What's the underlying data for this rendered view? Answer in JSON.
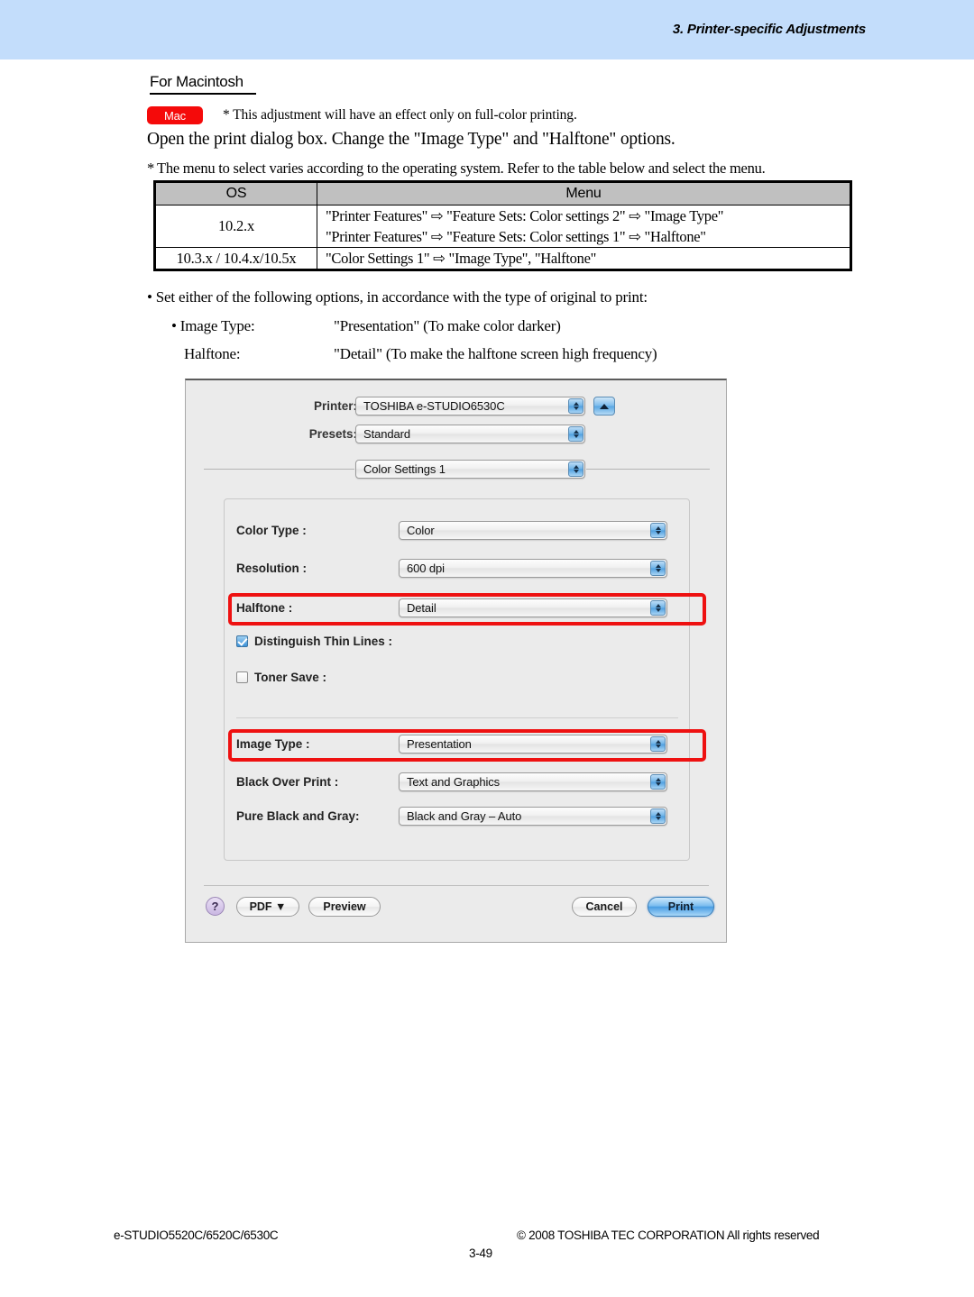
{
  "header": {
    "title": "3. Printer-specific Adjustments",
    "banner_color": "#c3ddfb"
  },
  "section": {
    "heading": "For Macintosh",
    "badge_label": "Mac",
    "badge_color": "#f50a0a",
    "badge_note": "* This adjustment will have an effect only on full-color printing.",
    "instruction": "Open the print dialog box.  Change the \"Image Type\" and \"Halftone\" options.",
    "table_note_star": "*",
    "table_note": "The menu to select varies according to the operating system.  Refer to the table below and select the menu."
  },
  "os_table": {
    "headers": [
      "OS",
      "Menu"
    ],
    "rows": [
      {
        "os": "10.2.x",
        "menu_lines": [
          "\"Printer Features\" ⇨ \"Feature Sets: Color settings 2\" ⇨ \"Image Type\"",
          "\"Printer Features\" ⇨ \"Feature Sets: Color settings 1\" ⇨ \"Halftone\""
        ]
      },
      {
        "os": "10.3.x / 10.4.x/10.5x",
        "menu_lines": [
          "\"Color Settings 1\" ⇨ \"Image Type\", \"Halftone\""
        ]
      }
    ]
  },
  "options": {
    "bullet_main": "• Set either of the following options, in accordance with the type of original to print:",
    "item1_label": "• Image Type:",
    "item1_value": "\"Presentation\" (To make color darker)",
    "item2_label": "Halftone:",
    "item2_value": "\"Detail\" (To make the halftone screen high frequency)"
  },
  "dialog": {
    "printer_label": "Printer:",
    "printer_value": "TOSHIBA e-STUDIO6530C",
    "presets_label": "Presets:",
    "presets_value": "Standard",
    "pane_value": "Color Settings 1",
    "settings": [
      {
        "label": "Color Type :",
        "value": "Color"
      },
      {
        "label": "Resolution :",
        "value": "600 dpi"
      },
      {
        "label": "Halftone :",
        "value": "Detail"
      }
    ],
    "checkboxes": [
      {
        "label": "Distinguish Thin Lines :",
        "checked": true
      },
      {
        "label": "Toner Save :",
        "checked": false
      }
    ],
    "settings2": [
      {
        "label": "Image Type :",
        "value": "Presentation"
      },
      {
        "label": "Black Over Print :",
        "value": "Text and Graphics"
      },
      {
        "label": "Pure Black and Gray:",
        "value": "Black and Gray – Auto"
      }
    ],
    "buttons": {
      "help": "?",
      "pdf": "PDF ▼",
      "preview": "Preview",
      "cancel": "Cancel",
      "print": "Print"
    },
    "highlight_color": "#ee1111"
  },
  "footer": {
    "left": "e-STUDIO5520C/6520C/6530C",
    "right": "© 2008 TOSHIBA TEC CORPORATION All rights reserved",
    "page": "3-49"
  }
}
